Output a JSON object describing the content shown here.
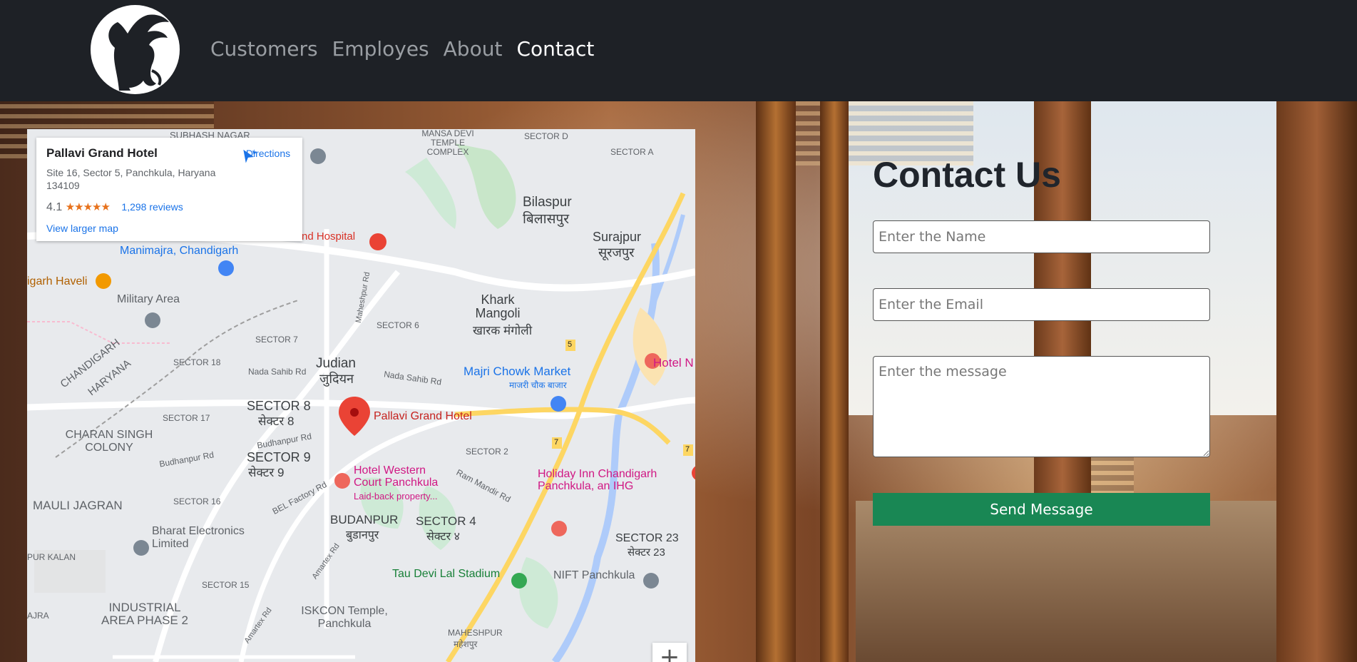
{
  "navbar": {
    "logo_icon": "winged-lion-logo-icon",
    "links": [
      {
        "label": "Customers",
        "active": false
      },
      {
        "label": "Employes",
        "active": false
      },
      {
        "label": "About",
        "active": false
      },
      {
        "label": "Contact",
        "active": true
      }
    ]
  },
  "map": {
    "place_name": "Pallavi Grand Hotel",
    "address": "Site 16, Sector 5, Panchkula, Haryana 134109",
    "rating": "4.1",
    "stars": "★★★★★",
    "reviews": "1,298 reviews",
    "directions_label": "Directions",
    "larger_map_label": "View larger map",
    "zoom_in_label": "+",
    "pin_label": "Pallavi Grand Hotel",
    "labels": {
      "subhash_nagar": "SUBHASH NAGAR",
      "mansa_devi": "MANSA DEVI TEMPLE COMPLEX",
      "sector_d": "SECTOR D",
      "sector_a": "SECTOR A",
      "bilaspur": "Bilaspur",
      "bilaspur_hi": "बिलासपुर",
      "surajpur": "Surajpur",
      "surajpur_hi": "सूरजपुर",
      "hospital": "nd Hospital",
      "manimajra": "Manimajra, Chandigarh",
      "haveli": "igarh Haveli",
      "military": "Military Area",
      "chandigarh": "CHANDIGARH",
      "haryana": "HARYANA",
      "sector7": "SECTOR 7",
      "sector6": "SECTOR 6",
      "khark": "Khark Mangoli",
      "khark_hi": "खारक मंगोली",
      "sector18": "SECTOR 18",
      "judian": "Judian",
      "judian_hi": "जुदियन",
      "majri": "Majri Chowk Market",
      "majri_hi": "माजरी चौक बाजार",
      "hotel_n": "Hotel N",
      "sector8": "SECTOR 8",
      "sector8_hi": "सेक्टर 8",
      "sector17": "SECTOR 17",
      "charan": "CHARAN SINGH COLONY",
      "sector9": "SECTOR 9",
      "sector9_hi": "सेक्टर 9",
      "sector2": "SECTOR 2",
      "western": "Hotel Western Court Panchkula",
      "laidback": "Laid-back property...",
      "holiday": "Holiday Inn Chandigarh Panchkula, an IHG",
      "mauli": "MAULI JAGRAN",
      "sector16": "SECTOR 16",
      "budanpur": "BUDANPUR",
      "budanpur_hi": "बुडानपुर",
      "sector4": "SECTOR 4",
      "sector4_hi": "सेक्टर ४",
      "sector23": "SECTOR 23",
      "sector23_hi": "सेक्टर 23",
      "bharat": "Bharat Electronics Limited",
      "purkalan": "PUR KALAN",
      "taudevi": "Tau Devi Lal Stadium",
      "nift": "NIFT Panchkula",
      "sector15": "SECTOR 15",
      "industrial": "INDUSTRIAL AREA PHASE 2",
      "iskcon": "ISKCON Temple, Panchkula",
      "maheshpur": "MAHESHPUR",
      "maheshpur_hi": "महेशपुर",
      "ajra": "AJRA",
      "road_maheshpur": "Maheshpur Rd",
      "road_nada": "Nada Sahib Rd",
      "road_budhanpur": "Budhanpur Rd",
      "road_bel": "BEL Factory Rd",
      "road_ram": "Ram Mandir Rd",
      "road_amartex": "Amartex Rd",
      "hw5": "5",
      "hw7": "7"
    }
  },
  "contact": {
    "title": "Contact Us",
    "name_placeholder": "Enter the Name",
    "email_placeholder": "Enter the Email",
    "message_placeholder": "Enter the message",
    "send_label": "Send Message"
  }
}
